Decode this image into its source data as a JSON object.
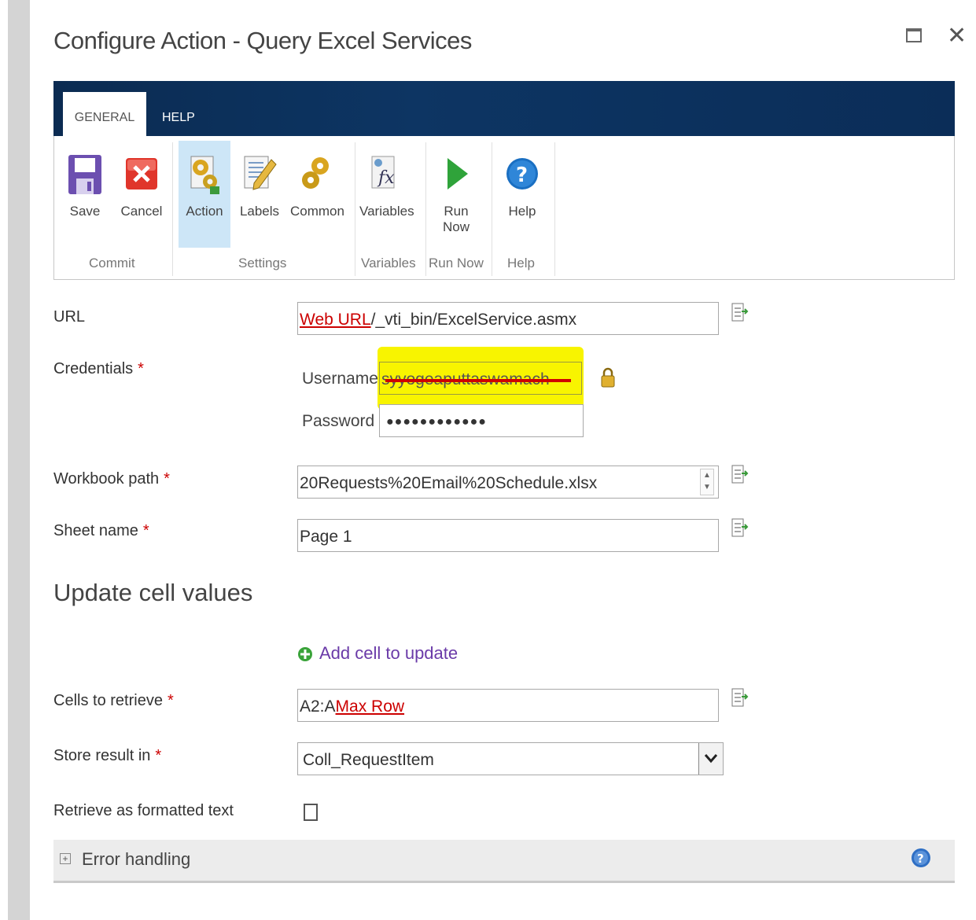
{
  "dialog": {
    "title": "Configure Action - Query Excel Services"
  },
  "ribbon": {
    "tabs": [
      {
        "label": "GENERAL"
      },
      {
        "label": "HELP"
      }
    ],
    "buttons": {
      "save": "Save",
      "cancel": "Cancel",
      "action": "Action",
      "labels": "Labels",
      "common": "Common",
      "variables": "Variables",
      "run_now_1": "Run",
      "run_now_2": "Now",
      "help": "Help"
    },
    "groups": {
      "commit": "Commit",
      "settings": "Settings",
      "variables": "Variables",
      "run_now": "Run Now",
      "help": "Help"
    }
  },
  "form": {
    "url": {
      "label": "URL",
      "ref_token": "Web URL",
      "suffix": "/_vti_bin/ExcelService.asmx"
    },
    "credentials": {
      "label": "Credentials",
      "username_label": "Username",
      "username_value": "syyogeaputtaswamach",
      "password_label": "Password",
      "password_value": "●●●●●●●●●●●●"
    },
    "workbook_path": {
      "label": "Workbook path",
      "value": "20Requests%20Email%20Schedule.xlsx"
    },
    "sheet_name": {
      "label": "Sheet name",
      "value": "Page 1"
    },
    "update_heading": "Update cell values",
    "add_cell_link": "Add cell to update",
    "cells_to_retrieve": {
      "label": "Cells to retrieve",
      "prefix": "A2:A",
      "ref_token": "Max Row"
    },
    "store_result": {
      "label": "Store result in",
      "value": "Coll_RequestItem"
    },
    "formatted_text": {
      "label": "Retrieve as formatted text"
    },
    "required_mark": "*"
  },
  "error_handling": {
    "label": "Error handling",
    "toggle": "+"
  },
  "colors": {
    "ribbon": "#0b2b52",
    "active_button": "#cde6f7",
    "reference_token": "#cc0000",
    "link": "#6a3aa8"
  }
}
